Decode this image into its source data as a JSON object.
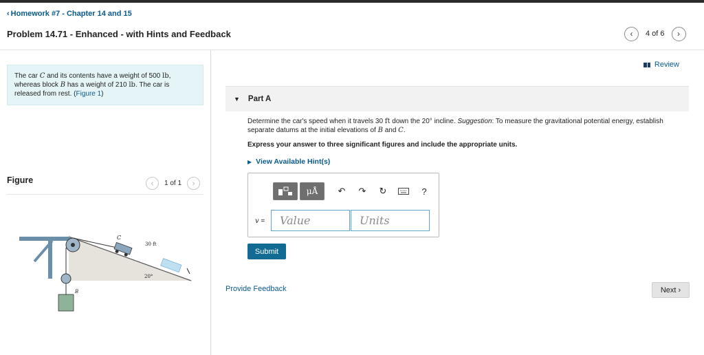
{
  "header": {
    "back_link": "Homework #7 - Chapter 14 and 15",
    "problem_title": "Problem 14.71 - Enhanced - with Hints and Feedback",
    "pager_count": "4 of 6"
  },
  "statement": {
    "text_before_c": "The car ",
    "var_c": "C",
    "text_mid1": " and its contents have a weight of 500 ",
    "unit1": "lb",
    "text_mid2": ", whereas block ",
    "var_b": "B",
    "text_mid3": " has a weight of 210 ",
    "unit2": "lb",
    "text_mid4": ". The car is released from rest. (",
    "figure_link": "Figure 1",
    "text_end": ")"
  },
  "figure": {
    "title": "Figure",
    "count": "1 of 1",
    "label_c": "C",
    "label_b": "B",
    "label_dist": "30 ft",
    "label_angle": "20°"
  },
  "review_label": "Review",
  "part": {
    "label": "Part A"
  },
  "question": {
    "q1": "Determine the car's speed when it travels 30 ",
    "q_unit": "ft",
    "q2": " down the 20° incline. ",
    "q_sugg": "Suggestion",
    "q3": ": To measure the gravitational potential energy, establish separate datums at the initial elevations of ",
    "q_b": "B",
    "q4": " and ",
    "q_c": "C",
    "q5": ".",
    "instruction": "Express your answer to three significant figures and include the appropriate units.",
    "hints_label": "View Available Hint(s)"
  },
  "answer": {
    "var_label": "v",
    "equals": " =",
    "value_placeholder": "Value",
    "units_placeholder": "Units",
    "unit_button": "μÅ",
    "help_icon": "?"
  },
  "buttons": {
    "submit": "Submit",
    "feedback": "Provide Feedback",
    "next": "Next"
  },
  "colors": {
    "link": "#0a5a8c",
    "submit_bg": "#116b93",
    "statement_bg": "#e5f4f6",
    "input_border": "#5aa5c8"
  }
}
